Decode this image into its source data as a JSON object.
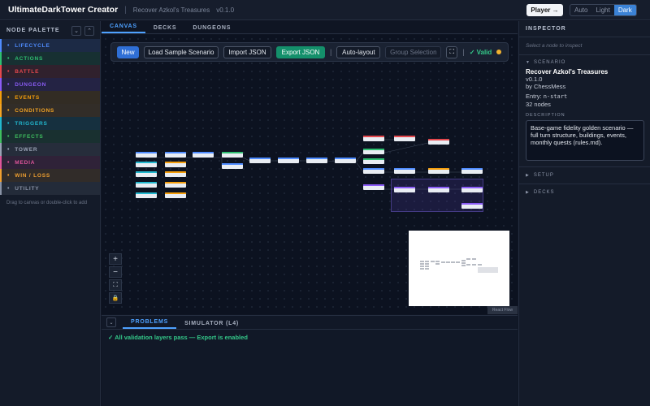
{
  "header": {
    "app_title": "UltimateDarkTower Creator",
    "separator": "|",
    "scenario_name": "Recover Azkol's Treasures",
    "scenario_version": "v0.1.0",
    "player_button": "Player →",
    "theme_options": [
      "Auto",
      "Light",
      "Dark"
    ],
    "theme_selected": "Dark"
  },
  "palette": {
    "title": "NODE PALETTE",
    "expand_icon": "⌄",
    "collapse_icon": "⌃",
    "categories": [
      {
        "label": "LIFECYCLE",
        "color": "#4f8cff"
      },
      {
        "label": "ACTIONS",
        "color": "#2fbf71"
      },
      {
        "label": "BATTLE",
        "color": "#e5484d"
      },
      {
        "label": "DUNGEON",
        "color": "#8b5cf6"
      },
      {
        "label": "EVENTS",
        "color": "#f59e0b"
      },
      {
        "label": "CONDITIONS",
        "color": "#f5a524"
      },
      {
        "label": "TRIGGERS",
        "color": "#22b8cf"
      },
      {
        "label": "EFFECTS",
        "color": "#3fbf5f"
      },
      {
        "label": "TOWER",
        "color": "#9aa3b5"
      },
      {
        "label": "MEDIA",
        "color": "#e0559b"
      },
      {
        "label": "WIN / LOSS",
        "color": "#f0a030"
      },
      {
        "label": "UTILITY",
        "color": "#8a93a6"
      }
    ],
    "hint": "Drag to canvas or double-click to add"
  },
  "tabs": [
    "CANVAS",
    "DECKS",
    "DUNGEONS"
  ],
  "active_tab": "CANVAS",
  "toolbar": {
    "new": "New",
    "load_sample": "Load Sample Scenario",
    "import": "Import JSON",
    "export": "Export JSON",
    "sep": "|",
    "auto_layout": "Auto-layout",
    "group_selection": "Group Selection",
    "fit_icon": "⛶",
    "valid": "✓ Valid",
    "status_color": "#f2b230"
  },
  "zoom_controls": {
    "zoom_in": "+",
    "zoom_out": "−",
    "fit": "⛶",
    "lock": "🔒"
  },
  "attribution": "React Flow",
  "bottom_panel": {
    "collapse_icon": "⌄",
    "tabs": [
      "PROBLEMS",
      "SIMULATOR (L4)"
    ],
    "active_tab": "PROBLEMS",
    "message": "✓ All validation layers pass — Export is enabled"
  },
  "inspector": {
    "title": "INSPECTOR",
    "hint": "Select a node to inspect",
    "scenario_section": "SCENARIO",
    "scenario_title": "Recover Azkol's Treasures",
    "version": "v0.1.0",
    "author": "by ChessMess",
    "entry_label": "Entry: ",
    "entry_value": "n-start",
    "node_count": "32 nodes",
    "description_label": "DESCRIPTION",
    "description": "Base-game fidelity golden scenario — full turn structure, buildings, events, monthly quests (rules.md).",
    "setup_section": "SETUP",
    "decks_section": "DECKS"
  }
}
